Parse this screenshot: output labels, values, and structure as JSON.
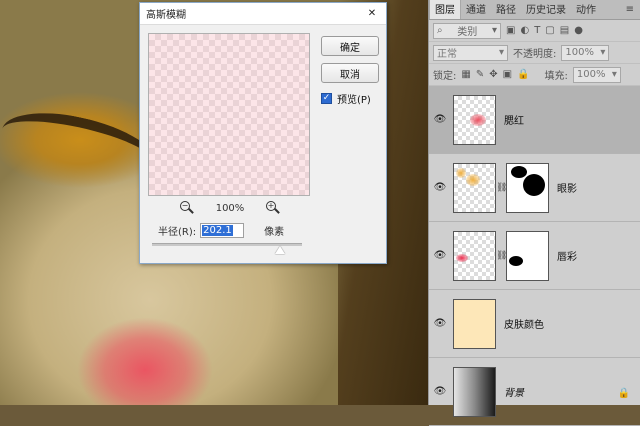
{
  "dialog": {
    "title": "高斯模糊",
    "close_glyph": "✕",
    "ok_label": "确定",
    "cancel_label": "取消",
    "preview_label": "预览(P)",
    "preview_checked": true,
    "zoom_out_glyph": "−",
    "zoom_in_glyph": "+",
    "zoom_level": "100%",
    "radius_label": "半径(R):",
    "radius_value": "202.1",
    "radius_unit": "像素",
    "slider_fraction": 0.85
  },
  "panel": {
    "tabs": [
      "图层",
      "通道",
      "路径",
      "历史记录",
      "动作"
    ],
    "active_tab": "图层",
    "menu_glyph": "≡",
    "filter_kind": "类别",
    "blend_mode": "正常",
    "opacity_label": "不透明度:",
    "opacity_value": "100%",
    "lock_label": "锁定:",
    "fill_label": "填充:",
    "fill_value": "100%",
    "layers": [
      {
        "name": "腮红",
        "selected": true
      },
      {
        "name": "眼影",
        "selected": false
      },
      {
        "name": "唇彩",
        "selected": false
      },
      {
        "name": "皮肤颜色",
        "selected": false
      },
      {
        "name": "背景",
        "selected": false
      }
    ]
  },
  "colors": {
    "accent": "#2d6bd1",
    "blush": "#ec5060",
    "skin_fill": "#fde7b8",
    "eye_shadow": "#f0b040"
  }
}
